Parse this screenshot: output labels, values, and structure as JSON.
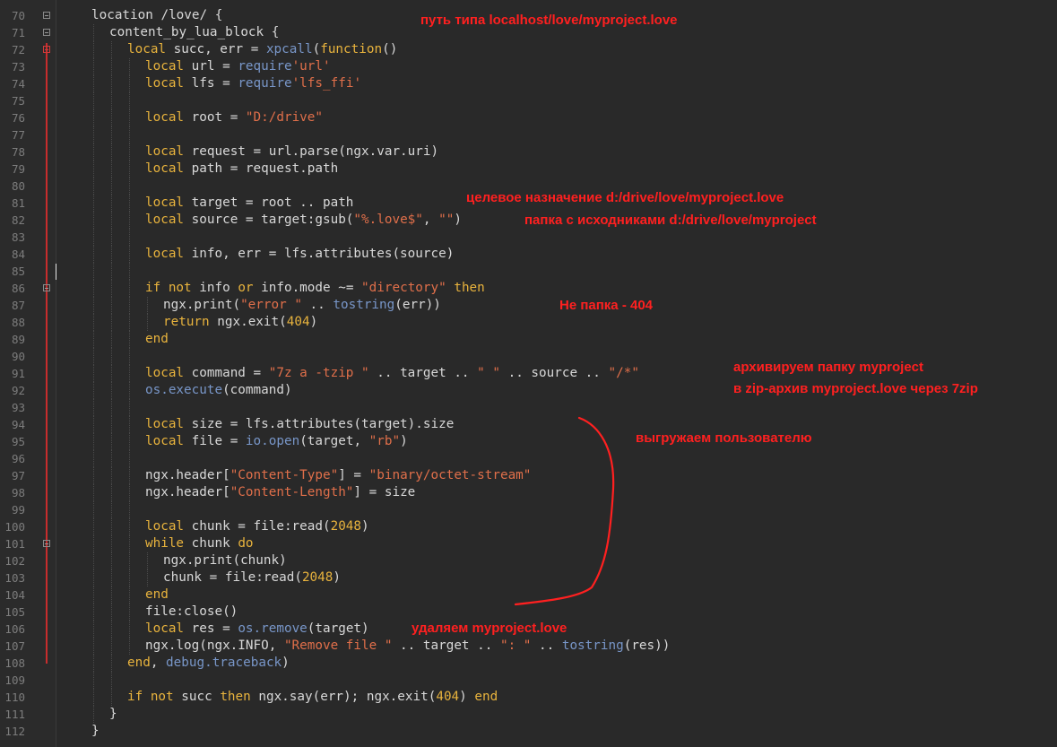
{
  "editor": {
    "lines": [
      {
        "n": "70",
        "fold": "box",
        "indent": 0,
        "tokens": [
          [
            "plain",
            "location /love/ {"
          ]
        ]
      },
      {
        "n": "71",
        "fold": "box",
        "indent": 1,
        "tokens": [
          [
            "plain",
            "content_by_lua_block {"
          ]
        ]
      },
      {
        "n": "72",
        "fold": "red",
        "indent": 2,
        "tokens": [
          [
            "kw",
            "local"
          ],
          [
            "plain",
            " succ, err = "
          ],
          [
            "fn",
            "xpcall"
          ],
          [
            "plain",
            "("
          ],
          [
            "kw",
            "function"
          ],
          [
            "plain",
            "()"
          ]
        ]
      },
      {
        "n": "73",
        "indent": 3,
        "tokens": [
          [
            "kw",
            "local"
          ],
          [
            "plain",
            " url = "
          ],
          [
            "fn",
            "require"
          ],
          [
            "str",
            "'url'"
          ]
        ]
      },
      {
        "n": "74",
        "indent": 3,
        "tokens": [
          [
            "kw",
            "local"
          ],
          [
            "plain",
            " lfs = "
          ],
          [
            "fn",
            "require"
          ],
          [
            "str",
            "'lfs_ffi'"
          ]
        ]
      },
      {
        "n": "75",
        "indent": 3,
        "tokens": []
      },
      {
        "n": "76",
        "indent": 3,
        "tokens": [
          [
            "kw",
            "local"
          ],
          [
            "plain",
            " root = "
          ],
          [
            "str",
            "\"D:/drive\""
          ]
        ]
      },
      {
        "n": "77",
        "indent": 3,
        "tokens": []
      },
      {
        "n": "78",
        "indent": 3,
        "tokens": [
          [
            "kw",
            "local"
          ],
          [
            "plain",
            " request = url.parse(ngx.var.uri)"
          ]
        ]
      },
      {
        "n": "79",
        "indent": 3,
        "tokens": [
          [
            "kw",
            "local"
          ],
          [
            "plain",
            " path = request.path"
          ]
        ]
      },
      {
        "n": "80",
        "indent": 3,
        "tokens": []
      },
      {
        "n": "81",
        "indent": 3,
        "tokens": [
          [
            "kw",
            "local"
          ],
          [
            "plain",
            " target = root .. path"
          ]
        ]
      },
      {
        "n": "82",
        "indent": 3,
        "tokens": [
          [
            "kw",
            "local"
          ],
          [
            "plain",
            " source = target:gsub("
          ],
          [
            "str",
            "\"%.love$\""
          ],
          [
            "plain",
            ", "
          ],
          [
            "str",
            "\"\""
          ],
          [
            "plain",
            ")"
          ]
        ]
      },
      {
        "n": "83",
        "indent": 3,
        "tokens": []
      },
      {
        "n": "84",
        "indent": 3,
        "tokens": [
          [
            "kw",
            "local"
          ],
          [
            "plain",
            " info, err = lfs.attributes(source)"
          ]
        ]
      },
      {
        "n": "85",
        "indent": 3,
        "tokens": []
      },
      {
        "n": "86",
        "fold": "box",
        "indent": 3,
        "tokens": [
          [
            "kw",
            "if not"
          ],
          [
            "plain",
            " info "
          ],
          [
            "kw",
            "or"
          ],
          [
            "plain",
            " info.mode ~= "
          ],
          [
            "str",
            "\"directory\""
          ],
          [
            "plain",
            " "
          ],
          [
            "kw",
            "then"
          ]
        ]
      },
      {
        "n": "87",
        "indent": 4,
        "tokens": [
          [
            "plain",
            "ngx.print("
          ],
          [
            "str",
            "\"error \""
          ],
          [
            "plain",
            " .. "
          ],
          [
            "fn",
            "tostring"
          ],
          [
            "plain",
            "(err))"
          ]
        ]
      },
      {
        "n": "88",
        "indent": 4,
        "tokens": [
          [
            "kw",
            "return"
          ],
          [
            "plain",
            " ngx.exit("
          ],
          [
            "num",
            "404"
          ],
          [
            "plain",
            ")"
          ]
        ]
      },
      {
        "n": "89",
        "indent": 3,
        "tokens": [
          [
            "kw",
            "end"
          ]
        ]
      },
      {
        "n": "90",
        "indent": 3,
        "tokens": []
      },
      {
        "n": "91",
        "indent": 3,
        "tokens": [
          [
            "kw",
            "local"
          ],
          [
            "plain",
            " command = "
          ],
          [
            "str",
            "\"7z a -tzip \""
          ],
          [
            "plain",
            " .. target .. "
          ],
          [
            "str",
            "\" \""
          ],
          [
            "plain",
            " .. source .. "
          ],
          [
            "str",
            "\"/*\""
          ]
        ]
      },
      {
        "n": "92",
        "indent": 3,
        "tokens": [
          [
            "fn",
            "os.execute"
          ],
          [
            "plain",
            "(command)"
          ]
        ]
      },
      {
        "n": "93",
        "indent": 3,
        "tokens": []
      },
      {
        "n": "94",
        "indent": 3,
        "tokens": [
          [
            "kw",
            "local"
          ],
          [
            "plain",
            " size = lfs.attributes(target).size"
          ]
        ]
      },
      {
        "n": "95",
        "indent": 3,
        "tokens": [
          [
            "kw",
            "local"
          ],
          [
            "plain",
            " file = "
          ],
          [
            "fn",
            "io.open"
          ],
          [
            "plain",
            "(target, "
          ],
          [
            "str",
            "\"rb\""
          ],
          [
            "plain",
            ")"
          ]
        ]
      },
      {
        "n": "96",
        "indent": 3,
        "tokens": []
      },
      {
        "n": "97",
        "indent": 3,
        "tokens": [
          [
            "plain",
            "ngx.header["
          ],
          [
            "str",
            "\"Content-Type\""
          ],
          [
            "plain",
            "] = "
          ],
          [
            "str",
            "\"binary/octet-stream\""
          ]
        ]
      },
      {
        "n": "98",
        "indent": 3,
        "tokens": [
          [
            "plain",
            "ngx.header["
          ],
          [
            "str",
            "\"Content-Length\""
          ],
          [
            "plain",
            "] = size"
          ]
        ]
      },
      {
        "n": "99",
        "indent": 3,
        "tokens": []
      },
      {
        "n": "100",
        "indent": 3,
        "tokens": [
          [
            "kw",
            "local"
          ],
          [
            "plain",
            " chunk = file:read("
          ],
          [
            "num",
            "2048"
          ],
          [
            "plain",
            ")"
          ]
        ]
      },
      {
        "n": "101",
        "fold": "box",
        "indent": 3,
        "tokens": [
          [
            "kw",
            "while"
          ],
          [
            "plain",
            " chunk "
          ],
          [
            "kw",
            "do"
          ]
        ]
      },
      {
        "n": "102",
        "indent": 4,
        "tokens": [
          [
            "plain",
            "ngx.print(chunk)"
          ]
        ]
      },
      {
        "n": "103",
        "indent": 4,
        "tokens": [
          [
            "plain",
            "chunk = file:read("
          ],
          [
            "num",
            "2048"
          ],
          [
            "plain",
            ")"
          ]
        ]
      },
      {
        "n": "104",
        "indent": 3,
        "tokens": [
          [
            "kw",
            "end"
          ]
        ]
      },
      {
        "n": "105",
        "indent": 3,
        "tokens": [
          [
            "plain",
            "file:close()"
          ]
        ]
      },
      {
        "n": "106",
        "indent": 3,
        "tokens": [
          [
            "kw",
            "local"
          ],
          [
            "plain",
            " res = "
          ],
          [
            "fn",
            "os.remove"
          ],
          [
            "plain",
            "(target)"
          ]
        ]
      },
      {
        "n": "107",
        "indent": 3,
        "tokens": [
          [
            "plain",
            "ngx.log(ngx.INFO, "
          ],
          [
            "str",
            "\"Remove file \""
          ],
          [
            "plain",
            " .. target .. "
          ],
          [
            "str",
            "\": \""
          ],
          [
            "plain",
            " .. "
          ],
          [
            "fn",
            "tostring"
          ],
          [
            "plain",
            "(res))"
          ]
        ]
      },
      {
        "n": "108",
        "indent": 2,
        "tokens": [
          [
            "kw",
            "end"
          ],
          [
            "plain",
            ", "
          ],
          [
            "fn",
            "debug.traceback"
          ],
          [
            "plain",
            ")"
          ]
        ]
      },
      {
        "n": "109",
        "indent": 2,
        "tokens": []
      },
      {
        "n": "110",
        "indent": 2,
        "tokens": [
          [
            "kw",
            "if not"
          ],
          [
            "plain",
            " succ "
          ],
          [
            "kw",
            "then"
          ],
          [
            "plain",
            " ngx.say(err); ngx.exit("
          ],
          [
            "num",
            "404"
          ],
          [
            "plain",
            ") "
          ],
          [
            "kw",
            "end"
          ]
        ]
      },
      {
        "n": "111",
        "indent": 1,
        "tokens": [
          [
            "plain",
            "}"
          ]
        ]
      },
      {
        "n": "112",
        "indent": 0,
        "tokens": [
          [
            "plain",
            "}"
          ]
        ]
      }
    ]
  },
  "annotations": {
    "path_hint": "путь типа localhost/love/myproject.love",
    "target_hint": "целевое назначение d:/drive/love/myproject.love",
    "source_hint": "папка с исходниками d:/drive/love/myproject",
    "not_folder": "Не папка - 404",
    "archive_line1": "архивируем папку myproject",
    "archive_line2": "в zip-архив myproject.love через 7zip",
    "upload": "выгружаем пользователю",
    "remove": "удаляем myproject.love"
  },
  "colors": {
    "background": "#292929",
    "keyword": "#e8b33d",
    "string": "#e06f4a",
    "builtin": "#7896c8",
    "annotation": "#ff2020"
  }
}
